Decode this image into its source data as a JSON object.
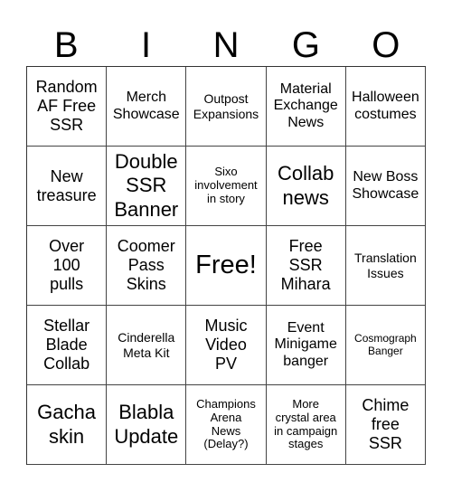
{
  "title_letters": [
    "B",
    "I",
    "N",
    "G",
    "O"
  ],
  "cells": [
    {
      "text": "Random\nAF Free\nSSR",
      "size": "m"
    },
    {
      "text": "Merch\nShowcase",
      "size": "n"
    },
    {
      "text": "Outpost\nExpansions",
      "size": "s"
    },
    {
      "text": "Material\nExchange\nNews",
      "size": "n"
    },
    {
      "text": "Halloween\ncostumes",
      "size": "n"
    },
    {
      "text": "New\ntreasure",
      "size": "m"
    },
    {
      "text": "Double\nSSR\nBanner",
      "size": "l"
    },
    {
      "text": "Sixo\ninvolvement\nin story",
      "size": "xs"
    },
    {
      "text": "Collab\nnews",
      "size": "l"
    },
    {
      "text": "New Boss\nShowcase",
      "size": "n"
    },
    {
      "text": "Over\n100\npulls",
      "size": "m"
    },
    {
      "text": "Coomer\nPass\nSkins",
      "size": "m"
    },
    {
      "text": "Free!",
      "size": "xl"
    },
    {
      "text": "Free\nSSR\nMihara",
      "size": "m"
    },
    {
      "text": "Translation\nIssues",
      "size": "s"
    },
    {
      "text": "Stellar\nBlade\nCollab",
      "size": "m"
    },
    {
      "text": "Cinderella\nMeta Kit",
      "size": "s"
    },
    {
      "text": "Music\nVideo\nPV",
      "size": "m"
    },
    {
      "text": "Event\nMinigame\nbanger",
      "size": "n"
    },
    {
      "text": "Cosmograph\nBanger",
      "size": "xxs"
    },
    {
      "text": "Gacha\nskin",
      "size": "l"
    },
    {
      "text": "Blabla\nUpdate",
      "size": "l"
    },
    {
      "text": "Champions\nArena\nNews\n(Delay?)",
      "size": "xs"
    },
    {
      "text": "More\ncrystal area\nin campaign\nstages",
      "size": "xs"
    },
    {
      "text": "Chime\nfree\nSSR",
      "size": "m"
    }
  ]
}
